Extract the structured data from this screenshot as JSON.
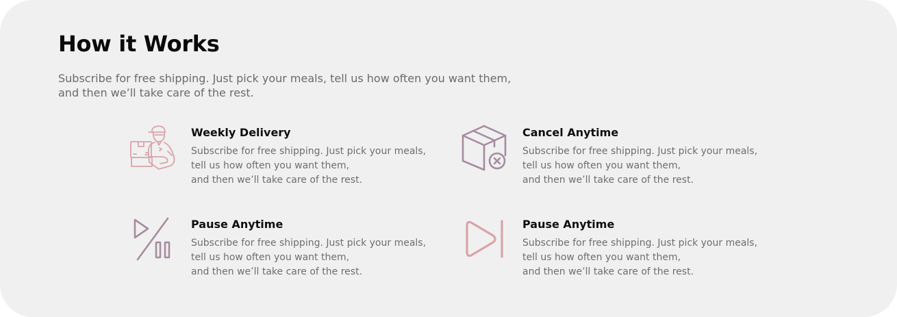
{
  "section": {
    "title": "How it Works",
    "intro_line1": "Subscribe for free shipping. Just pick your meals, tell us how often you want them,",
    "intro_line2": "and then we’ll take care of the rest."
  },
  "features": [
    {
      "title": "Weekly Delivery",
      "desc_line1": "Subscribe for free shipping. Just pick your meals,",
      "desc_line2": "tell us how often you want them,",
      "desc_line3": "and then we’ll take care of the rest.",
      "icon": "delivery-person-icon"
    },
    {
      "title": "Cancel Anytime",
      "desc_line1": "Subscribe for free shipping. Just pick your meals,",
      "desc_line2": "tell us how often you want them,",
      "desc_line3": "and then we’ll take care of the rest.",
      "icon": "box-cancel-icon"
    },
    {
      "title": "Pause Anytime",
      "desc_line1": "Subscribe for free shipping. Just pick your meals,",
      "desc_line2": "tell us how often you want them,",
      "desc_line3": "and then we’ll take care of the rest.",
      "icon": "play-pause-icon"
    },
    {
      "title": "Pause Anytime",
      "desc_line1": "Subscribe for free shipping. Just pick your meals,",
      "desc_line2": "tell us how often you want them,",
      "desc_line3": "and then we’ll take care of the rest.",
      "icon": "skip-next-icon"
    }
  ],
  "colors": {
    "card_background": "#f0f0f0",
    "icon_pink": "#d9a3a8",
    "icon_mauve": "#a68ba0",
    "heading": "#0a0a0a",
    "body_text": "#6b6b6b"
  }
}
